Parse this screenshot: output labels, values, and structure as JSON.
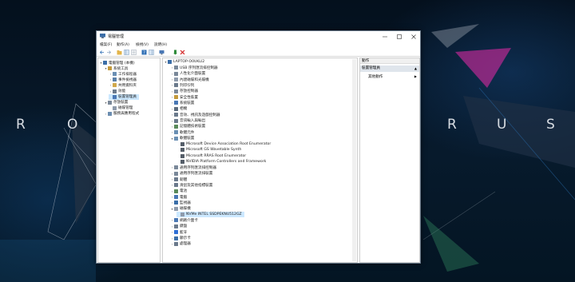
{
  "desktop": {
    "rog_left": [
      "R",
      "O"
    ],
    "rog_right": [
      "R",
      "U",
      "S"
    ]
  },
  "window": {
    "title": "電腦管理",
    "menu": [
      "檔案(F)",
      "動作(A)",
      "檢視(V)",
      "說明(H)"
    ]
  },
  "left_tree": [
    {
      "label": "電腦管理 (本機)",
      "expand": "▾",
      "icon": "#3b6ea8"
    },
    {
      "label": "系統工具",
      "expand": "▾",
      "icon": "#c49a3c"
    },
    {
      "label": "工作排程器",
      "expand": "›",
      "icon": "#6a8fb3"
    },
    {
      "label": "事件檢視器",
      "expand": "›",
      "icon": "#5a7fa8"
    },
    {
      "label": "共用資料夾",
      "expand": "›",
      "icon": "#d1a84a"
    },
    {
      "label": "效能",
      "expand": "›",
      "icon": "#6b7a8c"
    },
    {
      "label": "裝置管理員",
      "expand": "",
      "icon": "#4a78b5",
      "selected": true
    },
    {
      "label": "存放裝置",
      "expand": "▾",
      "icon": "#7a8899"
    },
    {
      "label": "磁碟管理",
      "expand": "",
      "icon": "#8d9aab"
    },
    {
      "label": "服務與應用程式",
      "expand": "›",
      "icon": "#6b8db0"
    }
  ],
  "device_tree": [
    {
      "label": "LAPTOP-O0UKLI2",
      "expand": "▾",
      "icon": "#3b6ea8"
    },
    {
      "label": "USB 序列匯流排控制器",
      "expand": "›",
      "icon": "#7a8899"
    },
    {
      "label": "人性化介面裝置",
      "expand": "›",
      "icon": "#7a8899"
    },
    {
      "label": "內建磁碟和光碟機",
      "expand": "›",
      "icon": "#8d9aab"
    },
    {
      "label": "列印佇列",
      "expand": "›",
      "icon": "#6b7a8c"
    },
    {
      "label": "存放控制器",
      "expand": "›",
      "icon": "#7a8899"
    },
    {
      "label": "安全性裝置",
      "expand": "›",
      "icon": "#c49a3c"
    },
    {
      "label": "系統裝置",
      "expand": "›",
      "icon": "#4a78b5"
    },
    {
      "label": "相機",
      "expand": "›",
      "icon": "#5b6b7c"
    },
    {
      "label": "音效、視訊及遊戲控制器",
      "expand": "›",
      "icon": "#6b7a8c"
    },
    {
      "label": "音訊輸入與輸出",
      "expand": "›",
      "icon": "#6b7a8c"
    },
    {
      "label": "記憶體技術裝置",
      "expand": "›",
      "icon": "#5a8a5a"
    },
    {
      "label": "軟體元件",
      "expand": "›",
      "icon": "#6a8fb3"
    },
    {
      "label": "軟體裝置",
      "expand": "▾",
      "icon": "#6a8fb3"
    },
    {
      "label": "Microsoft Device Association Root Enumerator",
      "expand": "",
      "icon": "#555e69"
    },
    {
      "label": "Microsoft GS Wavetable Synth",
      "expand": "",
      "icon": "#555e69"
    },
    {
      "label": "Microsoft RRAS Root Enumerator",
      "expand": "",
      "icon": "#555e69"
    },
    {
      "label": "NVIDIA Platform Controllers and Framework",
      "expand": "",
      "icon": "#555e69"
    },
    {
      "label": "通用序列匯流排控制器",
      "expand": "›",
      "icon": "#7a8899"
    },
    {
      "label": "通用序列匯流排裝置",
      "expand": "›",
      "icon": "#7a8899"
    },
    {
      "label": "韌體",
      "expand": "›",
      "icon": "#6b7a8c"
    },
    {
      "label": "滑鼠及其他指標裝置",
      "expand": "›",
      "icon": "#6b7a8c"
    },
    {
      "label": "電池",
      "expand": "›",
      "icon": "#5a8a5a"
    },
    {
      "label": "電腦",
      "expand": "›",
      "icon": "#4a78b5"
    },
    {
      "label": "監視器",
      "expand": "›",
      "icon": "#3b6ea8"
    },
    {
      "label": "磁碟機",
      "expand": "▾",
      "icon": "#8d9aab"
    },
    {
      "label": "NVMe INTEL SSDPEKNU512GZ",
      "expand": "",
      "icon": "#8d9aab",
      "selected": true
    },
    {
      "label": "網路介面卡",
      "expand": "›",
      "icon": "#4a78b5"
    },
    {
      "label": "鍵盤",
      "expand": "›",
      "icon": "#6b7a8c"
    },
    {
      "label": "藍牙",
      "expand": "›",
      "icon": "#2f6fd6"
    },
    {
      "label": "顯示卡",
      "expand": "›",
      "icon": "#3b6ea8"
    },
    {
      "label": "處理器",
      "expand": "›",
      "icon": "#6b7a8c"
    }
  ],
  "actions": {
    "header": "動作",
    "section": "裝置管理員",
    "more": "其他動作"
  },
  "colors": {
    "selection": "#cce8ff",
    "close": "#d12323"
  }
}
